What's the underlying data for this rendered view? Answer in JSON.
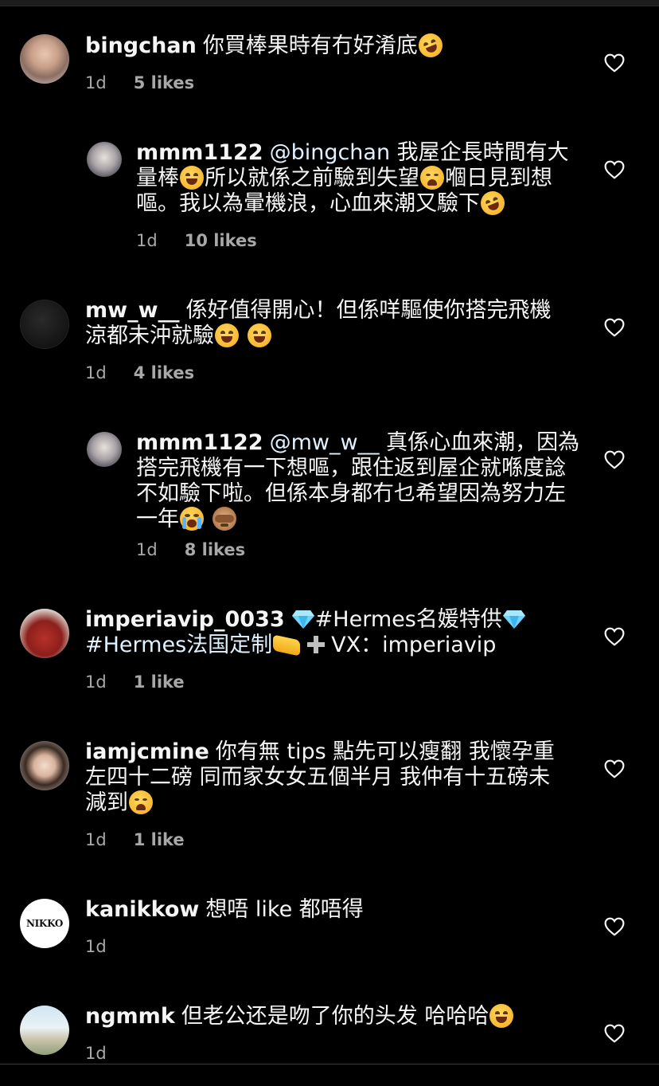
{
  "heart_color": "#f5f5f5",
  "comments": [
    {
      "username": "bingchan",
      "mention": "",
      "text": "你買棒果時有冇好淆底",
      "time": "1d",
      "likes": "5 likes"
    },
    {
      "username": "mmm1122",
      "mention": "@bingchan",
      "text1": "我屋企長時間有大量棒",
      "text2": "所以就係之前驗到失望",
      "text3": "嗰日見到想嘔。我以為暈機浪，心血來潮又驗下",
      "time": "1d",
      "likes": "10 likes"
    },
    {
      "username": "mw_w__",
      "mention": "",
      "text": "係好值得開心！但係咩驅使你搭完飛機涼都未沖就驗",
      "time": "1d",
      "likes": "4 likes"
    },
    {
      "username": "mmm1122",
      "mention": "@mw_w__",
      "text": "真係心血來潮，因為搭完飛機有一下想嘔，跟住返到屋企就喺度諗不如驗下啦。但係本身都冇乜希望因為努力左一年",
      "time": "1d",
      "likes": "8 likes"
    },
    {
      "username": "imperiavip_0033",
      "mention": "",
      "text1": "#Hermes名媛特供",
      "text2": "#Hermes法国定制",
      "text3": "VX：imperiavip",
      "time": "1d",
      "likes": "1 like"
    },
    {
      "username": "iamjcmine",
      "mention": "",
      "text": "你有無 tips 點先可以瘦翻 我懷孕重左四十二磅 同而家女女五個半月 我仲有十五磅未減到",
      "time": "1d",
      "likes": "1 like"
    },
    {
      "username": "kanikkow",
      "mention": "",
      "text": "想唔 like 都唔得",
      "time": "1d",
      "likes": "",
      "avatar_logo": "NIKKO"
    },
    {
      "username": "ngmmk",
      "mention": "",
      "text": "但老公还是吻了你的头发 哈哈哈",
      "time": "1d",
      "likes": ""
    }
  ]
}
